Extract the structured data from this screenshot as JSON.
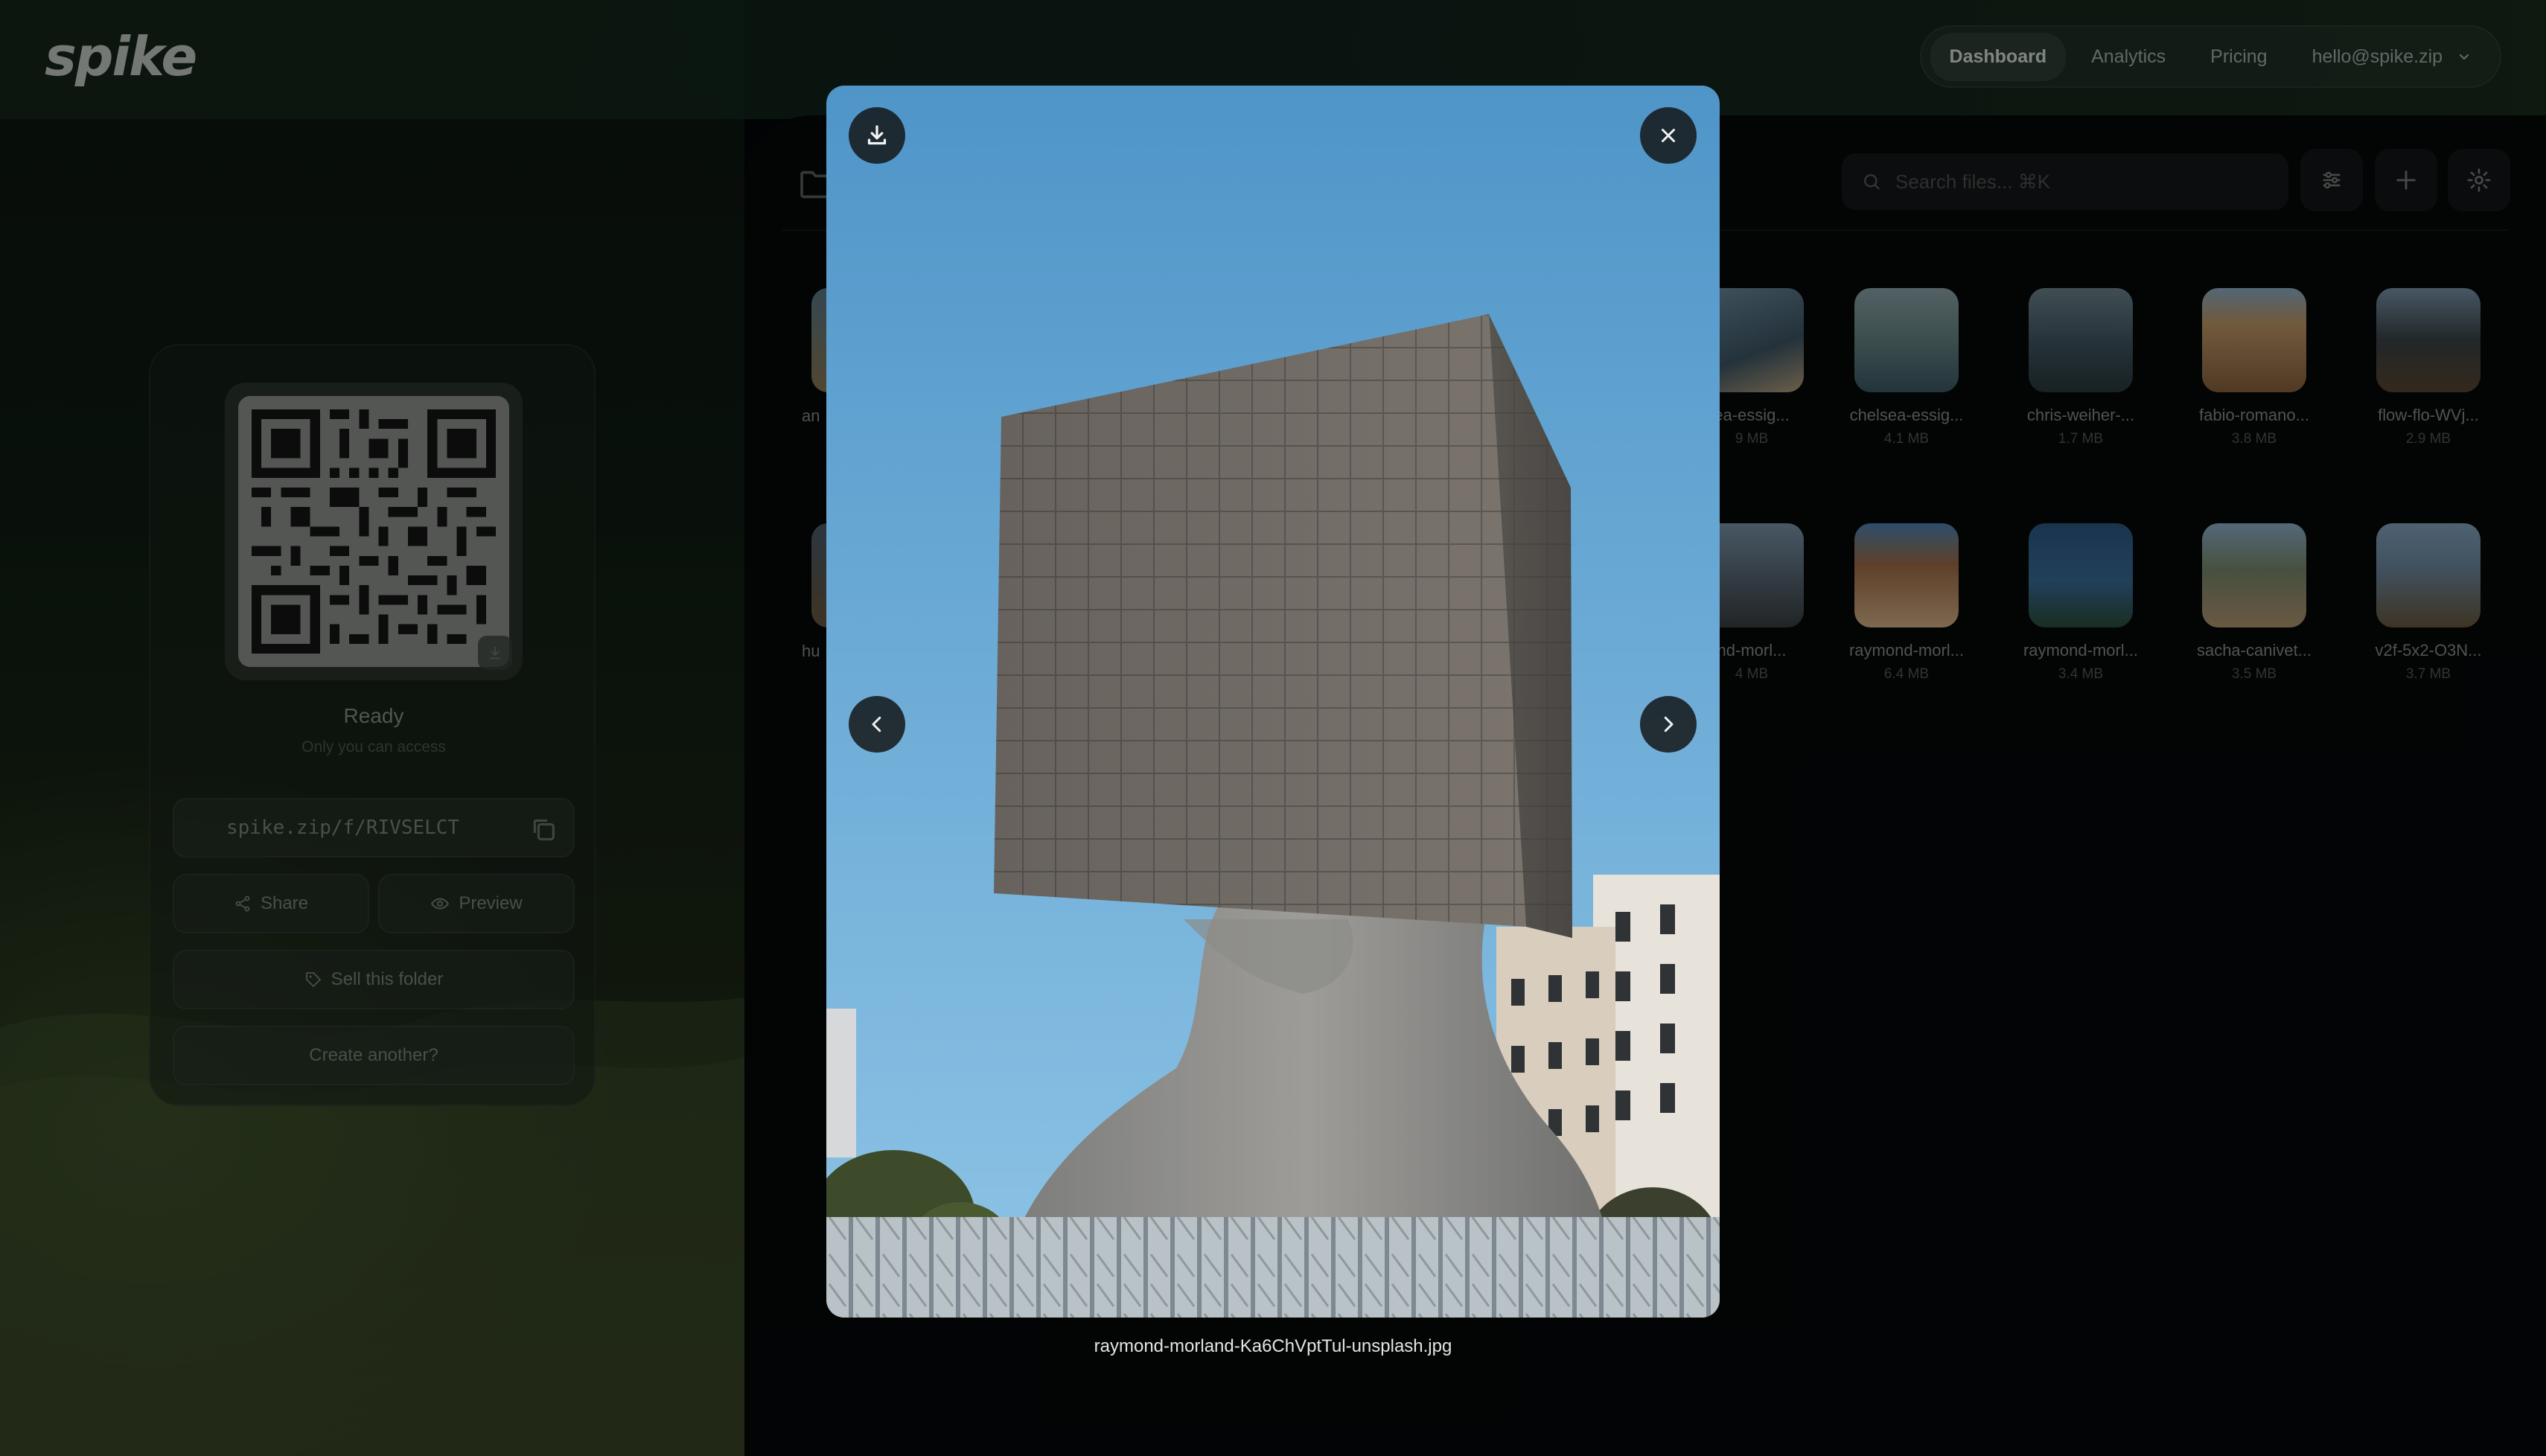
{
  "app": {
    "logo": "spike"
  },
  "nav": {
    "items": [
      {
        "label": "Dashboard",
        "active": true
      },
      {
        "label": "Analytics",
        "active": false
      },
      {
        "label": "Pricing",
        "active": false
      }
    ],
    "account": "hello@spike.zip"
  },
  "share_card": {
    "status_title": "Ready",
    "status_subtitle": "Only you can access",
    "url": "spike.zip/f/RIVSELCT",
    "share_label": "Share",
    "preview_label": "Preview",
    "sell_label": "Sell this folder",
    "create_label": "Create another?"
  },
  "toolbar": {
    "search_placeholder": "Search files... ⌘K"
  },
  "files": {
    "row1": [
      {
        "name": "ea-essig...",
        "size": "9 MB",
        "color": "#5e7f93"
      },
      {
        "name": "chelsea-essig...",
        "size": "4.1 MB",
        "color": "#6d8a8a"
      },
      {
        "name": "chris-weiher-...",
        "size": "1.7 MB",
        "color": "#3f5560"
      },
      {
        "name": "fabio-romano...",
        "size": "3.8 MB",
        "color": "#b08a5a"
      },
      {
        "name": "flow-flo-WVj...",
        "size": "2.9 MB",
        "color": "#3b4448"
      }
    ],
    "row2": [
      {
        "name": "nd-morl...",
        "size": "4 MB",
        "color": "#596a78"
      },
      {
        "name": "raymond-morl...",
        "size": "6.4 MB",
        "color": "#a36f47"
      },
      {
        "name": "raymond-morl...",
        "size": "3.4 MB",
        "color": "#2d5a86"
      },
      {
        "name": "sacha-canivet...",
        "size": "3.5 MB",
        "color": "#7d8a6e"
      },
      {
        "name": "v2f-5x2-O3N...",
        "size": "3.7 MB",
        "color": "#6f8aa0"
      }
    ],
    "partial_left_labels": [
      "an",
      "hu"
    ]
  },
  "viewer": {
    "caption": "raymond-morland-Ka6ChVptTul-unsplash.jpg"
  },
  "colors": {
    "sky": "#5ea6d4",
    "stone": "#6f6d69",
    "accent_bg": "#0c150f"
  }
}
